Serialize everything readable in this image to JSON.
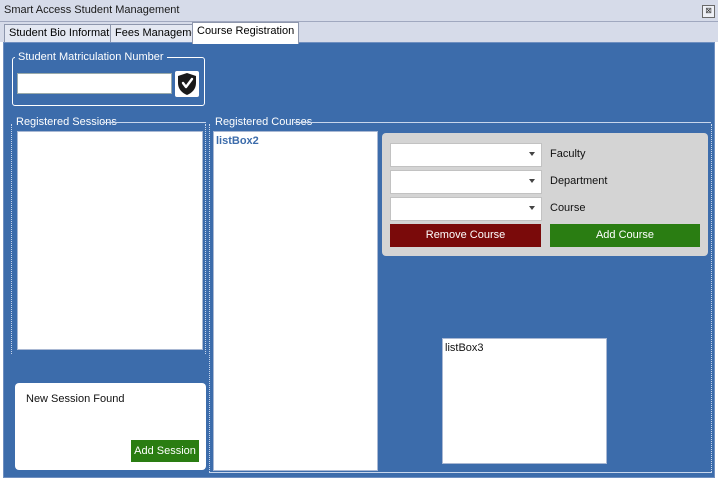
{
  "window": {
    "title": "Smart Access Student Management",
    "close_glyph": "⊠"
  },
  "tabs": [
    {
      "label": "Student Bio Information"
    },
    {
      "label": "Fees Management"
    },
    {
      "label": "Course Registration"
    }
  ],
  "matric": {
    "group_label": "Student Matriculation Number",
    "value": ""
  },
  "sessions": {
    "group_label": "Registered Sessions",
    "new_session_text": "New Session Found",
    "add_button": "Add Session"
  },
  "courses": {
    "group_label": "Registered Courses",
    "listbox2": "listBox2",
    "listbox3": "listBox3"
  },
  "filters": [
    {
      "label": "Faculty",
      "value": ""
    },
    {
      "label": "Department",
      "value": ""
    },
    {
      "label": "Course",
      "value": ""
    }
  ],
  "actions": {
    "remove": "Remove Course",
    "add": "Add Course"
  },
  "colors": {
    "panel": "#3c6cab",
    "remove": "#7a0a0a",
    "add": "#2a7d12"
  }
}
